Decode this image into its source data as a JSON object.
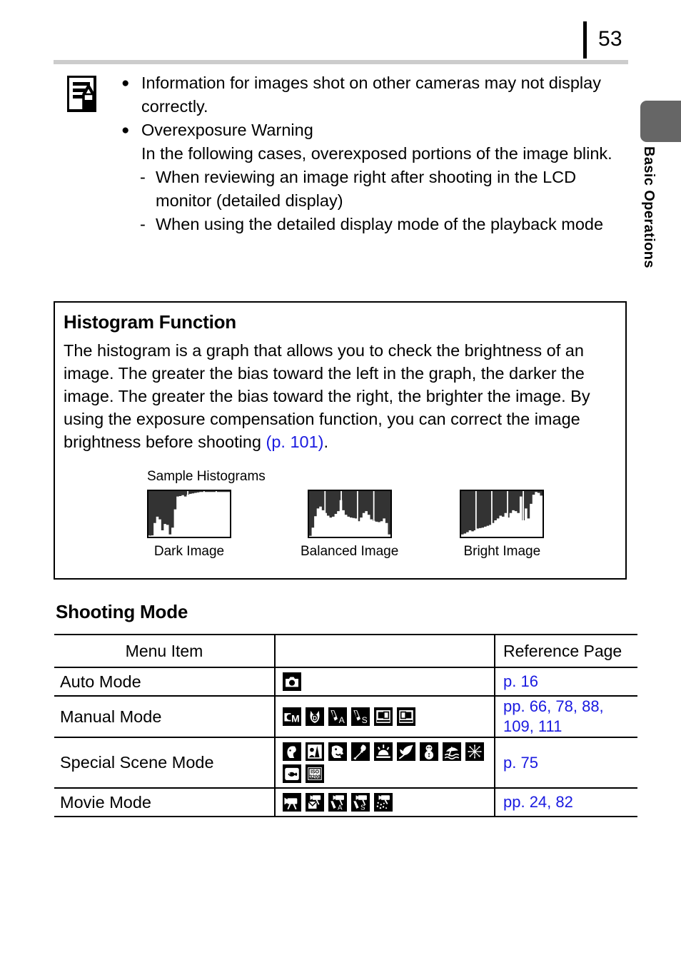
{
  "page": {
    "number": "53",
    "chapter_tab_label": "Basic Operations",
    "chapter_tab_color": "#666666",
    "link_color": "#1a1ae0"
  },
  "note": {
    "icon": "note-pencil-icon",
    "items": [
      {
        "bullet": "●",
        "text": "Information for images shot on other cameras may not display correctly."
      },
      {
        "bullet": "●",
        "text": "Overexposure Warning",
        "continuation": "In the following cases, overexposed portions of the image blink.",
        "sub_items": [
          {
            "dash": "-",
            "text": "When reviewing an image right after shooting in the LCD monitor (detailed display)"
          },
          {
            "dash": "-",
            "text": "When using the detailed display mode of the playback mode"
          }
        ]
      }
    ]
  },
  "histogram_box": {
    "title": "Histogram Function",
    "paragraph_part1": "The histogram is a graph that allows you to check the brightness of an image. The greater the bias toward the left in the graph, the darker the image. The greater the bias toward the right, the brighter the image. By using the exposure compensation function, you can correct the image brightness before shooting ",
    "paragraph_ref": "(p. 101)",
    "paragraph_part2": ".",
    "samples_caption": "Sample Histograms",
    "samples": [
      {
        "label": "Dark Image"
      },
      {
        "label": "Balanced Image"
      },
      {
        "label": "Bright Image"
      }
    ]
  },
  "chart_data": [
    {
      "type": "area",
      "title": "Dark Image",
      "xlabel": "",
      "ylabel": "",
      "grid": true,
      "gridlines_at": [
        0.25,
        0.5,
        0.75
      ],
      "x": [
        0,
        1,
        2,
        3,
        4,
        5,
        6,
        7,
        8,
        9,
        10,
        11,
        12,
        13,
        14,
        15,
        16,
        17,
        18,
        19,
        20,
        21,
        22,
        23,
        24,
        25,
        26,
        27,
        28,
        29,
        30,
        31
      ],
      "values": [
        0.97,
        0.98,
        0.97,
        0.7,
        0.56,
        0.62,
        0.86,
        0.72,
        0.74,
        0.95,
        0.8,
        0.4,
        0.12,
        0.11,
        0.09,
        0.12,
        0.08,
        0.06,
        0.05,
        0.04,
        0.03,
        0.02,
        0.02,
        0.02,
        0.02,
        0.02,
        0.02,
        0.02,
        0.02,
        0.02,
        0.02,
        0.02
      ],
      "ylim": [
        0,
        1
      ]
    },
    {
      "type": "area",
      "title": "Balanced Image",
      "xlabel": "",
      "ylabel": "",
      "grid": true,
      "gridlines_at": [
        0.2,
        0.4,
        0.6,
        0.8
      ],
      "x": [
        0,
        1,
        2,
        3,
        4,
        5,
        6,
        7,
        8,
        9,
        10,
        11,
        12,
        13,
        14,
        15,
        16,
        17,
        18,
        19,
        20,
        21,
        22,
        23,
        24,
        25,
        26,
        27,
        28,
        29,
        30,
        31
      ],
      "values": [
        0.02,
        0.2,
        0.45,
        0.62,
        0.66,
        0.58,
        0.52,
        0.46,
        0.42,
        0.44,
        0.5,
        0.56,
        0.8,
        0.58,
        0.48,
        0.44,
        0.42,
        0.41,
        0.4,
        0.34,
        0.42,
        0.52,
        0.56,
        0.48,
        0.38,
        0.35,
        0.33,
        0.32,
        0.34,
        0.4,
        0.3,
        0.05
      ],
      "ylim": [
        0,
        1
      ]
    },
    {
      "type": "area",
      "title": "Bright Image",
      "xlabel": "",
      "ylabel": "",
      "grid": true,
      "gridlines_at": [
        0.2,
        0.4,
        0.6,
        0.8
      ],
      "x": [
        0,
        1,
        2,
        3,
        4,
        5,
        6,
        7,
        8,
        9,
        10,
        11,
        12,
        13,
        14,
        15,
        16,
        17,
        18,
        19,
        20,
        21,
        22,
        23,
        24,
        25,
        26,
        27,
        28,
        29,
        30,
        31
      ],
      "values": [
        0.05,
        0.07,
        0.1,
        0.14,
        0.12,
        0.14,
        0.18,
        0.19,
        0.2,
        0.22,
        0.24,
        0.26,
        0.3,
        0.36,
        0.4,
        0.46,
        0.44,
        0.52,
        0.42,
        0.52,
        0.58,
        0.56,
        0.52,
        0.88,
        0.36,
        0.62,
        0.4,
        0.72,
        0.92,
        0.98,
        0.96,
        0.9
      ],
      "ylim": [
        0,
        1
      ]
    }
  ],
  "shooting_mode": {
    "heading": "Shooting Mode",
    "columns": [
      "Menu Item",
      "",
      "Reference Page"
    ],
    "rows": [
      {
        "menu_item": "Auto Mode",
        "icons": [
          "auto-camera-icon"
        ],
        "reference": "p. 16"
      },
      {
        "menu_item": "Manual Mode",
        "icons": [
          "manual-camera-m-icon",
          "digital-macro-icon",
          "color-accent-a-icon",
          "color-swap-s-icon",
          "stitch-assist-left-icon",
          "stitch-assist-right-icon"
        ],
        "reference": "pp. 66, 78, 88, 109, 111"
      },
      {
        "menu_item": "Special Scene Mode",
        "icons": [
          "portrait-icon",
          "night-snapshot-icon",
          "kids-and-pets-icon",
          "indoor-icon",
          "sunset-icon",
          "foliage-icon",
          "snow-icon",
          "beach-icon",
          "fireworks-icon",
          "aquarium-icon",
          "iso-3200-icon"
        ],
        "reference": "p. 75"
      },
      {
        "menu_item": "Movie Mode",
        "icons": [
          "movie-standard-icon",
          "movie-compact-icon",
          "movie-color-accent-icon",
          "movie-color-swap-icon",
          "movie-time-lapse-icon"
        ],
        "reference": "pp. 24, 82"
      }
    ]
  }
}
